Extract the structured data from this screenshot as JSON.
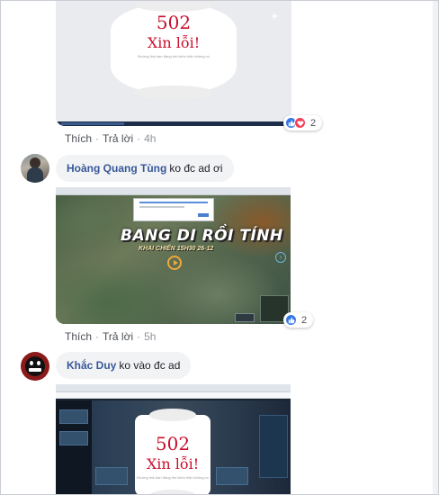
{
  "comments": [
    {
      "id": "c1",
      "shot": {
        "error_code": "502",
        "error_title": "Xin lỗi!",
        "error_desc": "Đường link bạn đang tìm kiếm hiện không có"
      },
      "like_label": "Thích",
      "reply_label": "Trả lời",
      "time": "4h",
      "reactions": {
        "count": "2",
        "types": [
          "like",
          "love"
        ]
      }
    },
    {
      "id": "c2",
      "author": "Hoàng Quang Tùng",
      "text": "ko đc ad ơi",
      "shot": {
        "game_title": "BANG DI RỒI TÍNH",
        "game_subtitle": "KHAI CHIẾN 15H30 26-12"
      },
      "like_label": "Thích",
      "reply_label": "Trả lời",
      "time": "5h",
      "reactions": {
        "count": "2",
        "types": [
          "like"
        ]
      }
    },
    {
      "id": "c3",
      "author": "Khắc Duy",
      "text": "ko vào đc ad",
      "shot": {
        "error_code": "502",
        "error_title": "Xin lỗi!",
        "error_desc": "Đường link bạn đang tìm kiếm hiện không có"
      }
    }
  ],
  "colors": {
    "author": "#385898",
    "bubble": "#f2f3f5",
    "like": "#3578e5",
    "love": "#f33e58",
    "error_red": "#c8102e"
  },
  "icons": {
    "like": "thumbs-up-icon",
    "love": "heart-icon"
  }
}
